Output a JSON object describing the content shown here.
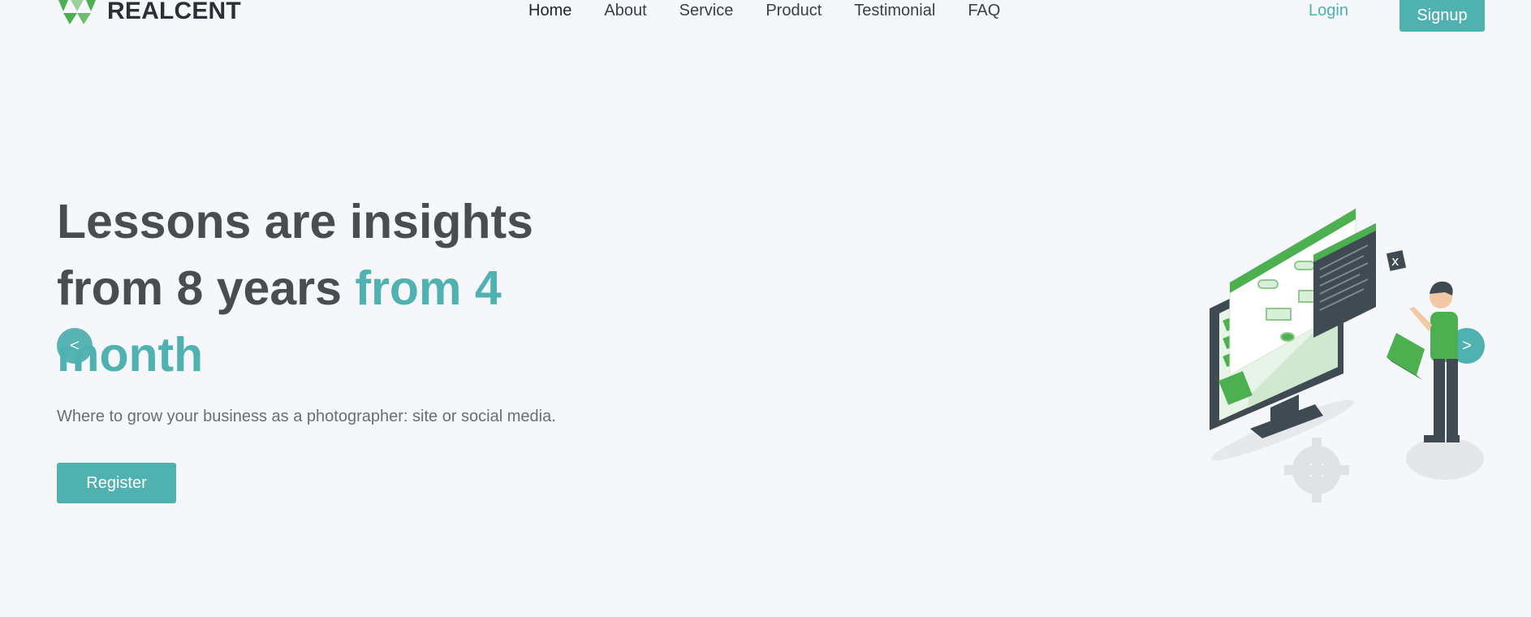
{
  "header": {
    "brand": "REALCENT",
    "nav": [
      {
        "label": "Home",
        "active": true
      },
      {
        "label": "About"
      },
      {
        "label": "Service"
      },
      {
        "label": "Product"
      },
      {
        "label": "Testimonial"
      },
      {
        "label": "FAQ"
      }
    ],
    "login": "Login",
    "signup": "Signup"
  },
  "hero": {
    "title_part1": "Lessons are insights from 8 years ",
    "title_accent": "from 4 month",
    "subtitle": "Where to grow your business as a photographer: site or social media.",
    "register": "Register"
  },
  "carousel": {
    "prev": "<",
    "next": ">"
  },
  "colors": {
    "accent": "#4fb1b0",
    "illustration_green": "#4caf50",
    "background": "#f5f7fb"
  },
  "icons": [
    "logo-icon",
    "hero-illustration",
    "gear-icon"
  ]
}
